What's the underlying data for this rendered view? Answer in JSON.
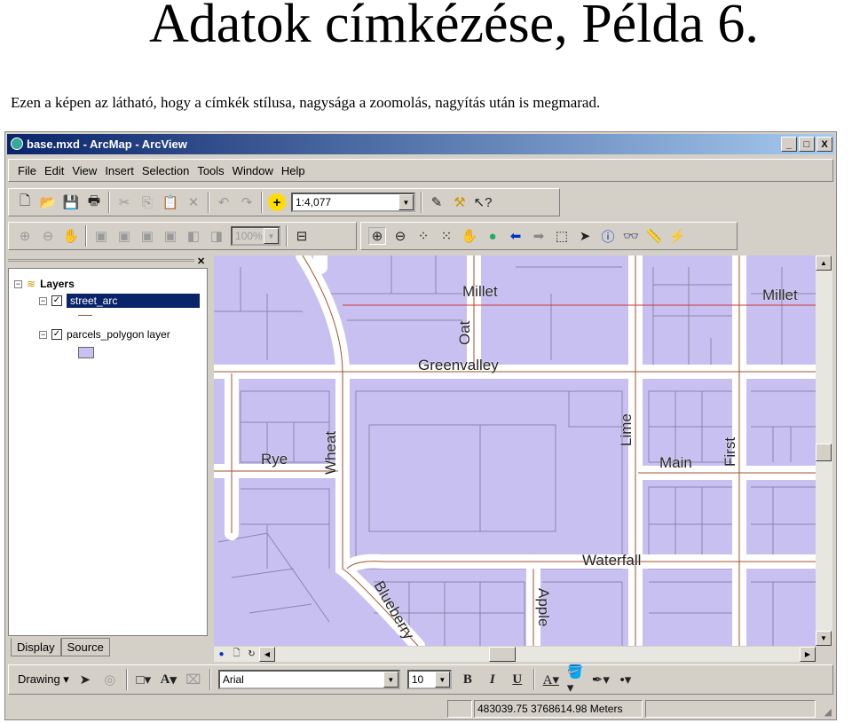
{
  "slide": {
    "title": "Adatok címkézése, Példa 6.",
    "subtitle": "Ezen a képen az látható, hogy a címkék stílusa, nagysága a zoomolás, nagyítás után is megmarad."
  },
  "window": {
    "title": "base.mxd - ArcMap - ArcView",
    "controls": [
      "_",
      "□",
      "X"
    ]
  },
  "menu": [
    "File",
    "Edit",
    "View",
    "Insert",
    "Selection",
    "Tools",
    "Window",
    "Help"
  ],
  "standard_toolbar": {
    "scale": "1:4,077",
    "icons": [
      "new-icon",
      "open-icon",
      "save-icon",
      "print-icon",
      "cut-icon",
      "copy-icon",
      "paste-icon",
      "delete-icon",
      "undo-icon",
      "redo-icon",
      "add-data-icon",
      "editor-icon",
      "arctoolbox-icon",
      "whats-this-icon"
    ]
  },
  "layout_toolbar": {
    "zoom_percent": "100%"
  },
  "tools_toolbar": {
    "icons": [
      "zoom-in-icon",
      "zoom-out-icon",
      "fixed-zoom-in-icon",
      "fixed-zoom-out-icon",
      "pan-icon",
      "full-extent-icon",
      "back-icon",
      "forward-icon",
      "select-features-icon",
      "select-elements-icon",
      "identify-icon",
      "find-icon",
      "measure-icon",
      "hyperlink-icon"
    ]
  },
  "toc": {
    "root": "Layers",
    "layers": [
      {
        "name": "street_arc",
        "checked": true,
        "selected": true,
        "symbol_color": "#a0522d"
      },
      {
        "name": "parcels_polygon layer",
        "checked": true,
        "symbol_color": "#c9c0f2"
      }
    ],
    "tabs": [
      "Display",
      "Source"
    ]
  },
  "map": {
    "labels": {
      "millet1": "Millet",
      "millet2": "Millet",
      "oat": "Oat",
      "greenvalley": "Greenvalley",
      "lime": "Lime",
      "first": "First",
      "wheat": "Wheat",
      "rye": "Rye",
      "main": "Main",
      "waterfall": "Waterfall",
      "apple": "Apple",
      "blueberry": "Blueberry"
    },
    "colors": {
      "parcel": "#c9c0f2",
      "street": "#a0522d",
      "road": "#ffffff"
    }
  },
  "drawing_toolbar": {
    "label": "Drawing",
    "font": "Arial",
    "size": "10",
    "bold": "B",
    "italic": "I",
    "underline": "U",
    "text_a": "A"
  },
  "status": {
    "coords": "483039.75  3768614.98 Meters"
  }
}
